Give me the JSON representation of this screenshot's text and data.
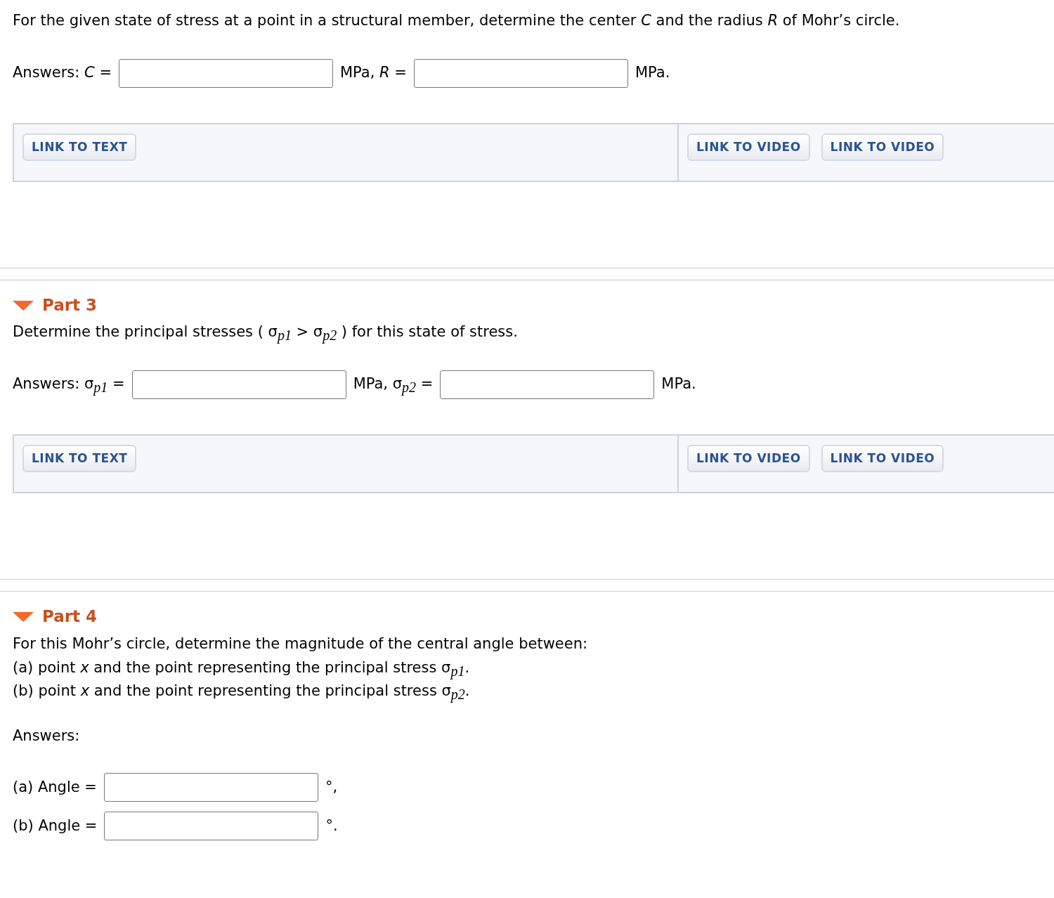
{
  "parts": [
    {
      "prompt": [
        "For the given state of stress at a point in a structural member, determine the center *C* and the radius *R* of Mohr’s circle."
      ],
      "answer_rows": [
        [
          {
            "kind": "text",
            "text": "Answers: *C* ="
          },
          {
            "kind": "field"
          },
          {
            "kind": "text",
            "text": "MPa, *R* ="
          },
          {
            "kind": "field"
          },
          {
            "kind": "text",
            "text": "MPa."
          }
        ]
      ],
      "resources": {
        "text_links": [
          "LINK TO TEXT"
        ],
        "video_links": [
          "LINK TO VIDEO",
          "LINK TO VIDEO"
        ]
      }
    },
    {
      "title": "Part 3",
      "expanded": true,
      "prompt": [
        "Determine the principal stresses ( σ$_{p1}$ > σ$_{p2}$ ) for this state of stress."
      ],
      "answer_rows": [
        [
          {
            "kind": "text",
            "text": "Answers: σ$_{p1}$ ="
          },
          {
            "kind": "field"
          },
          {
            "kind": "text",
            "text": "MPa, σ$_{p2}$ ="
          },
          {
            "kind": "field"
          },
          {
            "kind": "text",
            "text": "MPa."
          }
        ]
      ],
      "resources": {
        "text_links": [
          "LINK TO TEXT"
        ],
        "video_links": [
          "LINK TO VIDEO",
          "LINK TO VIDEO"
        ]
      }
    },
    {
      "title": "Part 4",
      "expanded": true,
      "prompt": [
        "For this Mohr’s circle, determine the magnitude of the central angle between:",
        "(a) point *x* and the point representing the principal stress σ$_{p1}$.",
        "(b) point *x* and the point representing the principal stress σ$_{p2}$."
      ],
      "answers_label": "Answers:",
      "answer_rows": [
        [
          {
            "kind": "text",
            "text": "(a) Angle ="
          },
          {
            "kind": "field"
          },
          {
            "kind": "text",
            "text": "°,"
          }
        ],
        [
          {
            "kind": "text",
            "text": "(b) Angle ="
          },
          {
            "kind": "field"
          },
          {
            "kind": "text",
            "text": "°."
          }
        ]
      ]
    }
  ]
}
